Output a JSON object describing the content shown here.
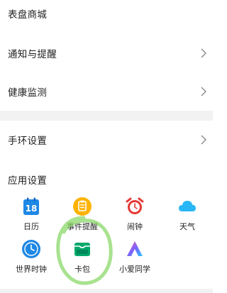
{
  "menu": {
    "items": [
      {
        "label": "表盘商城"
      },
      {
        "label": "通知与提醒"
      },
      {
        "label": "健康监测"
      },
      {
        "label": "手环设置"
      }
    ]
  },
  "apps_section": {
    "title": "应用设置",
    "apps": [
      {
        "label": "日历",
        "icon": "calendar-icon",
        "calendar_day": "18",
        "color": "#1e88e5"
      },
      {
        "label": "事件提醒",
        "icon": "clipboard-icon",
        "color": "#ffb300"
      },
      {
        "label": "闹钟",
        "icon": "alarm-clock-icon",
        "color": "#e53935"
      },
      {
        "label": "天气",
        "icon": "cloud-icon",
        "color": "#29b6f6"
      },
      {
        "label": "世界时钟",
        "icon": "clock-icon",
        "color": "#1e88e5"
      },
      {
        "label": "卡包",
        "icon": "wallet-icon",
        "color": "#00a86b"
      },
      {
        "label": "小爱同学",
        "icon": "xiaoai-icon",
        "color": "#6a5cff"
      }
    ]
  },
  "annotation_color": "#8bd86a"
}
